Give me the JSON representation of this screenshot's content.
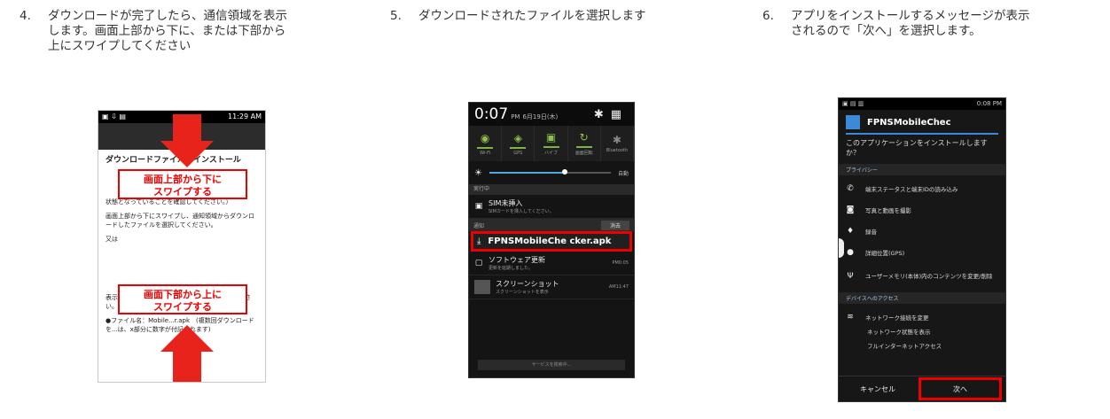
{
  "steps": [
    {
      "num": "4.",
      "lines": [
        "ダウンロードが完了したら、通信領域を表示",
        "します。画面上部から下に、または下部から",
        "上にスワイプしてください"
      ]
    },
    {
      "num": "5.",
      "lines": [
        "ダウンロードされたファイルを選択します"
      ]
    },
    {
      "num": "6.",
      "lines": [
        "アプリをインストールするメッセージが表示",
        "されるので「次へ」を選択します。"
      ]
    }
  ],
  "screen1": {
    "status_time": "11:29 AM",
    "heading": "ダウンロードファイルをインストール",
    "callout_top": [
      "画面上部から下に",
      "スワイプする"
    ],
    "callout_bottom": [
      "画面下部から上に",
      "スワイプする"
    ],
    "para1": "状態となっていることを確認してください。）",
    "para2": "画面上部から下にスワイプし、通知領域からダウンロードしたファイルを選択してください。",
    "para3": "又は",
    "para4": "表示されるため、「インストール」を選択してください。",
    "para5": "●ファイル名：Mobile...r.apk　(複数回ダウンロードを...は、x部分に数字が付記されます)"
  },
  "screen2": {
    "time": "0:07",
    "ampm": "PM",
    "date": "6月19日(木)",
    "toggles": [
      "Wi-Fi",
      "GPS",
      "バイブ",
      "画面回転",
      "Bluetooth"
    ],
    "auto_label": "自動",
    "section_running": "実行中",
    "sim_title": "SIM未挿入",
    "sim_sub": "SIMカードを挿入してください。",
    "notif_label": "通知",
    "clear_label": "消去",
    "apk_name": "FPNSMobileChe cker.apk",
    "update_title": "ソフトウェア更新",
    "update_sub": "更新を延期しました。",
    "update_time": "PM0:05",
    "shot_title": "スクリーンショット",
    "shot_sub": "スクリーンショットを表示",
    "shot_time": "AM11:47",
    "footer": "サービスを検索中..."
  },
  "screen3": {
    "status_time": "0:08 PM",
    "app_name": "FPNSMobileChec",
    "question": "このアプリケーションをインストールしますか？",
    "section_privacy": "プライバシー",
    "perms": [
      {
        "icon": "phone-icon",
        "label": "端末ステータスと端末IDの読み込み"
      },
      {
        "icon": "camera-icon",
        "label": "写真と動画を撮影"
      },
      {
        "icon": "mic-icon",
        "label": "録音"
      },
      {
        "icon": "location-icon",
        "label": "詳細位置(GPS)"
      },
      {
        "icon": "usb-icon",
        "label": "ユーザーメモリ(本体)内のコンテンツを変更/削除"
      }
    ],
    "section_device": "デバイスへのアクセス",
    "net_lines": [
      "ネットワーク接続を変更",
      "ネットワーク状態を表示",
      "フルインターネットアクセス"
    ],
    "cancel": "キャンセル",
    "next": "次へ"
  },
  "colors": {
    "highlight": "#e00000",
    "arrow": "#e8231b"
  }
}
